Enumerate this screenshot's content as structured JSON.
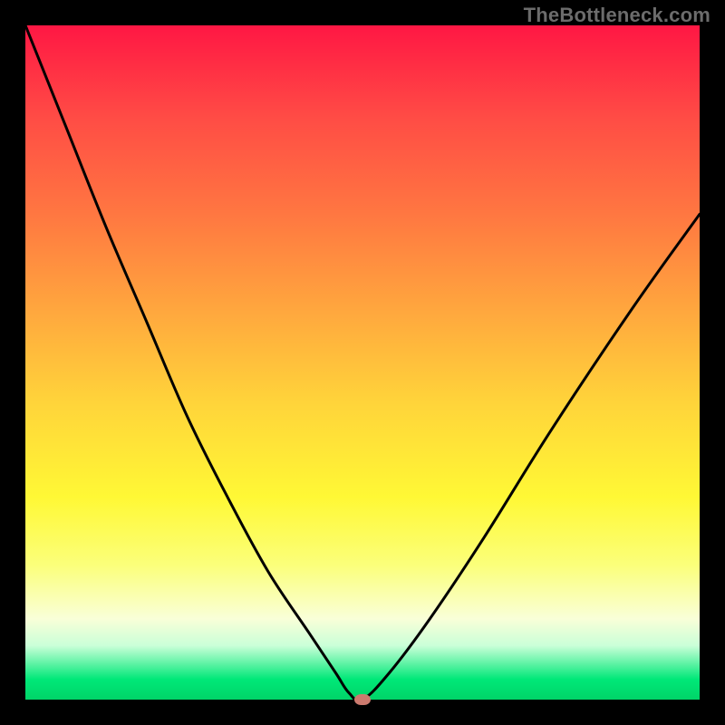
{
  "watermark": "TheBottleneck.com",
  "chart_data": {
    "type": "line",
    "title": "",
    "xlabel": "",
    "ylabel": "",
    "xlim": [
      0,
      100
    ],
    "ylim": [
      0,
      100
    ],
    "grid": false,
    "legend": false,
    "series": [
      {
        "name": "bottleneck-curve",
        "x": [
          0,
          6,
          12,
          18,
          24,
          30,
          36,
          42,
          46,
          48,
          50,
          54,
          60,
          68,
          78,
          90,
          100
        ],
        "values": [
          100,
          85,
          70,
          56,
          42,
          30,
          19,
          10,
          4,
          1,
          0,
          4,
          12,
          24,
          40,
          58,
          72
        ]
      }
    ],
    "marker": {
      "x": 50,
      "y": 0,
      "label": "optimal-point"
    },
    "colors": {
      "curve": "#000000",
      "marker": "#cc7a6e",
      "gradient_top": "#ff1744",
      "gradient_mid": "#fff835",
      "gradient_bottom": "#00d468"
    }
  }
}
